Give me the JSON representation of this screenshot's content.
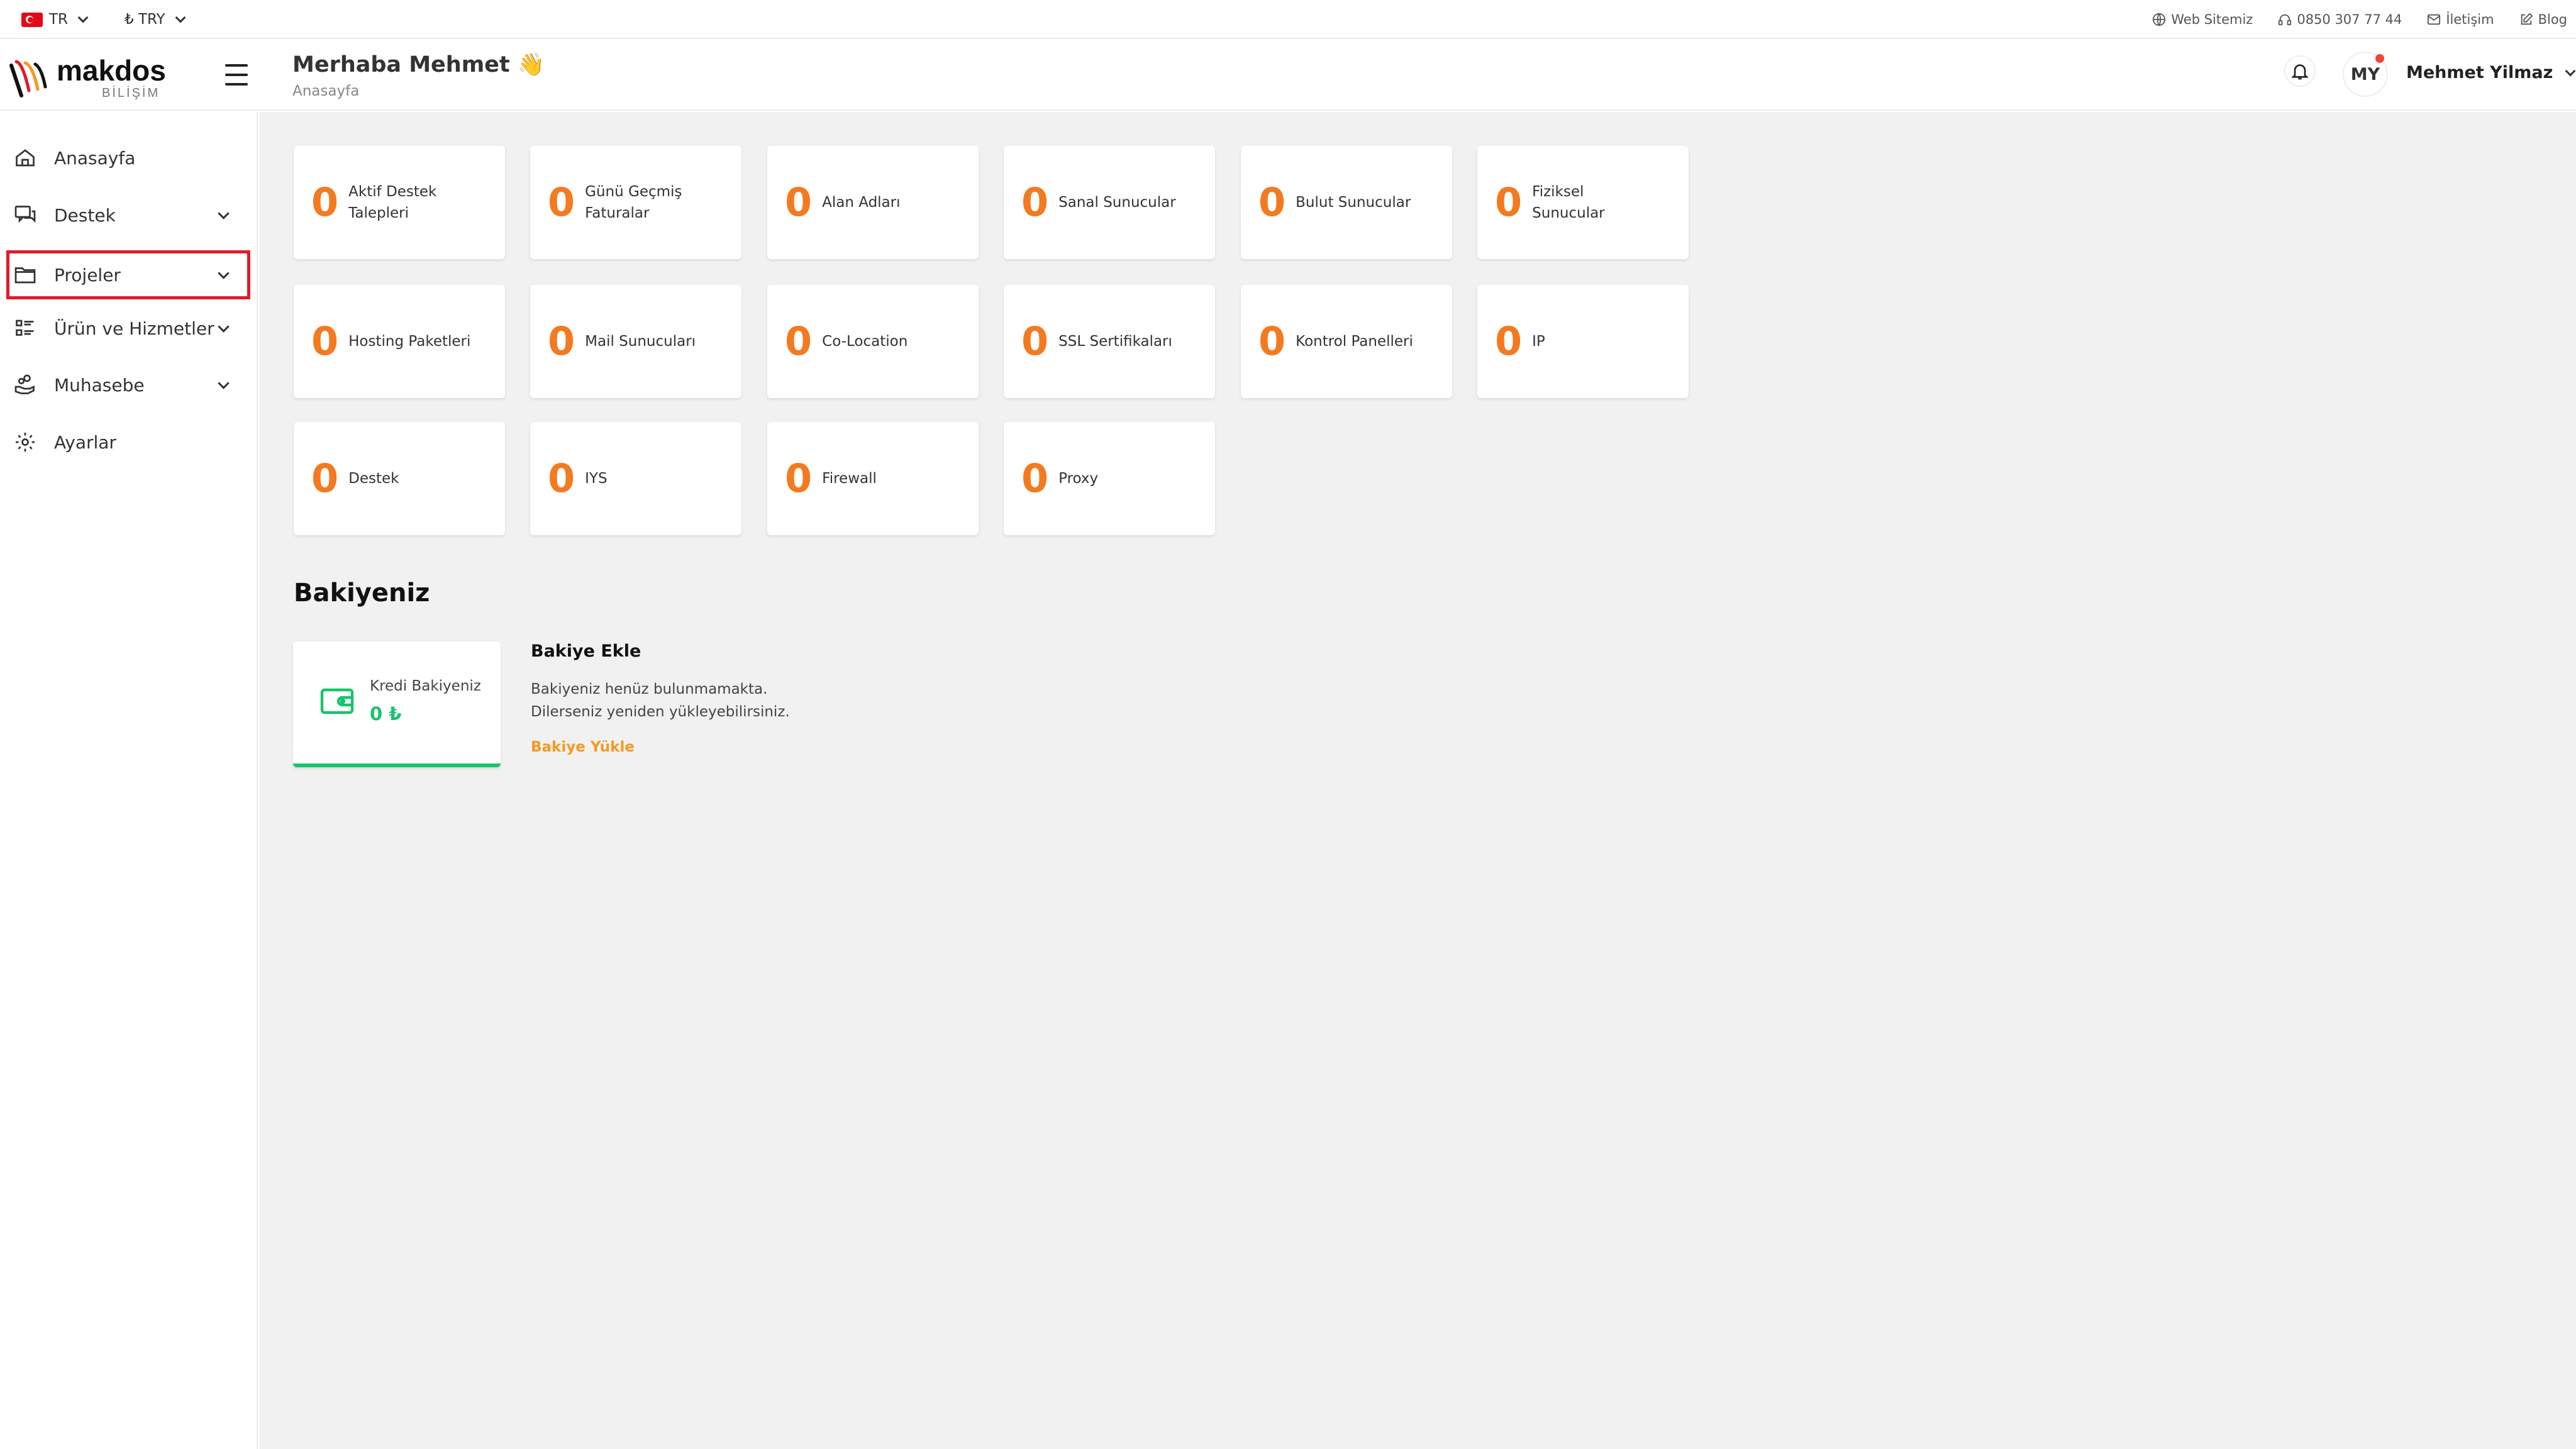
{
  "topbar": {
    "lang": "TR",
    "currency": "₺ TRY",
    "links": [
      {
        "label": "Web Sitemiz",
        "icon": "globe-icon"
      },
      {
        "label": "0850 307 77 44",
        "icon": "headset-icon"
      },
      {
        "label": "İletişim",
        "icon": "mail-icon"
      },
      {
        "label": "Blog",
        "icon": "edit-icon"
      }
    ]
  },
  "header": {
    "logo_text": "makdos",
    "logo_sub": "BİLİŞİM",
    "greeting": "Merhaba Mehmet 👋",
    "breadcrumb": "Anasayfa",
    "avatar_initials": "MY",
    "user_name": "Mehmet Yilmaz"
  },
  "sidebar": {
    "items": [
      {
        "label": "Anasayfa",
        "icon": "home-icon",
        "expandable": false
      },
      {
        "label": "Destek",
        "icon": "chat-icon",
        "expandable": true
      },
      {
        "label": "Projeler",
        "icon": "folder-icon",
        "expandable": true,
        "highlighted": true
      },
      {
        "label": "Ürün ve Hizmetler",
        "icon": "list-icon",
        "expandable": true
      },
      {
        "label": "Muhasebe",
        "icon": "hand-coins-icon",
        "expandable": true
      },
      {
        "label": "Ayarlar",
        "icon": "gear-icon",
        "expandable": false
      }
    ]
  },
  "stats": [
    {
      "value": "0",
      "label": "Aktif Destek Talepleri"
    },
    {
      "value": "0",
      "label": "Günü Geçmiş Faturalar"
    },
    {
      "value": "0",
      "label": "Alan Adları"
    },
    {
      "value": "0",
      "label": "Sanal Sunucular"
    },
    {
      "value": "0",
      "label": "Bulut Sunucular"
    },
    {
      "value": "0",
      "label": "Fiziksel Sunucular"
    },
    {
      "value": "0",
      "label": "Hosting Paketleri"
    },
    {
      "value": "0",
      "label": "Mail Sunucuları"
    },
    {
      "value": "0",
      "label": "Co-Location"
    },
    {
      "value": "0",
      "label": "SSL Sertifikaları"
    },
    {
      "value": "0",
      "label": "Kontrol Panelleri"
    },
    {
      "value": "0",
      "label": "IP"
    },
    {
      "value": "0",
      "label": "Destek"
    },
    {
      "value": "0",
      "label": "IYS"
    },
    {
      "value": "0",
      "label": "Firewall"
    },
    {
      "value": "0",
      "label": "Proxy"
    }
  ],
  "balance": {
    "section_title": "Bakiyeniz",
    "credit_label": "Kredi Bakiyeniz",
    "credit_value": "0 ₺",
    "add_title": "Bakiye Ekle",
    "add_desc_1": "Bakiyeniz henüz bulunmamakta.",
    "add_desc_2": "Dilerseniz yeniden yükleyebilirsiniz.",
    "add_link": "Bakiye Yükle"
  },
  "colors": {
    "accent_orange": "#f47a20",
    "success_green": "#19c36b",
    "highlight_red": "#e01b2a",
    "link_orange": "#f49a20"
  }
}
